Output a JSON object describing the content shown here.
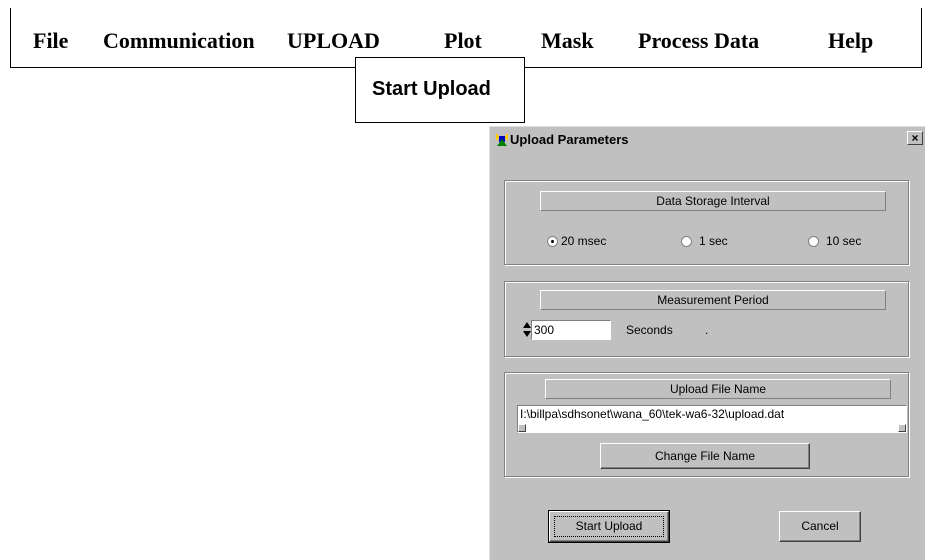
{
  "menu": {
    "items": [
      "File",
      "Communication",
      "UPLOAD",
      "Plot",
      "Mask",
      "Process Data",
      "Help"
    ],
    "dropdown_item": "Start Upload"
  },
  "dialog": {
    "title": "Upload Parameters",
    "close_symbol": "×",
    "storage_interval": {
      "header": "Data Storage Interval",
      "options": [
        "20 msec",
        "1 sec",
        "10 sec"
      ],
      "selected": "20 msec"
    },
    "measurement_period": {
      "header": "Measurement Period",
      "value": "300",
      "unit": "Seconds",
      "trailing": "."
    },
    "upload_file": {
      "header": "Upload File Name",
      "path": "I:\\billpa\\sdhsonet\\wana_60\\tek-wa6-32\\upload.dat",
      "change_button": "Change File Name"
    },
    "start_button": "Start Upload",
    "cancel_button": "Cancel"
  }
}
